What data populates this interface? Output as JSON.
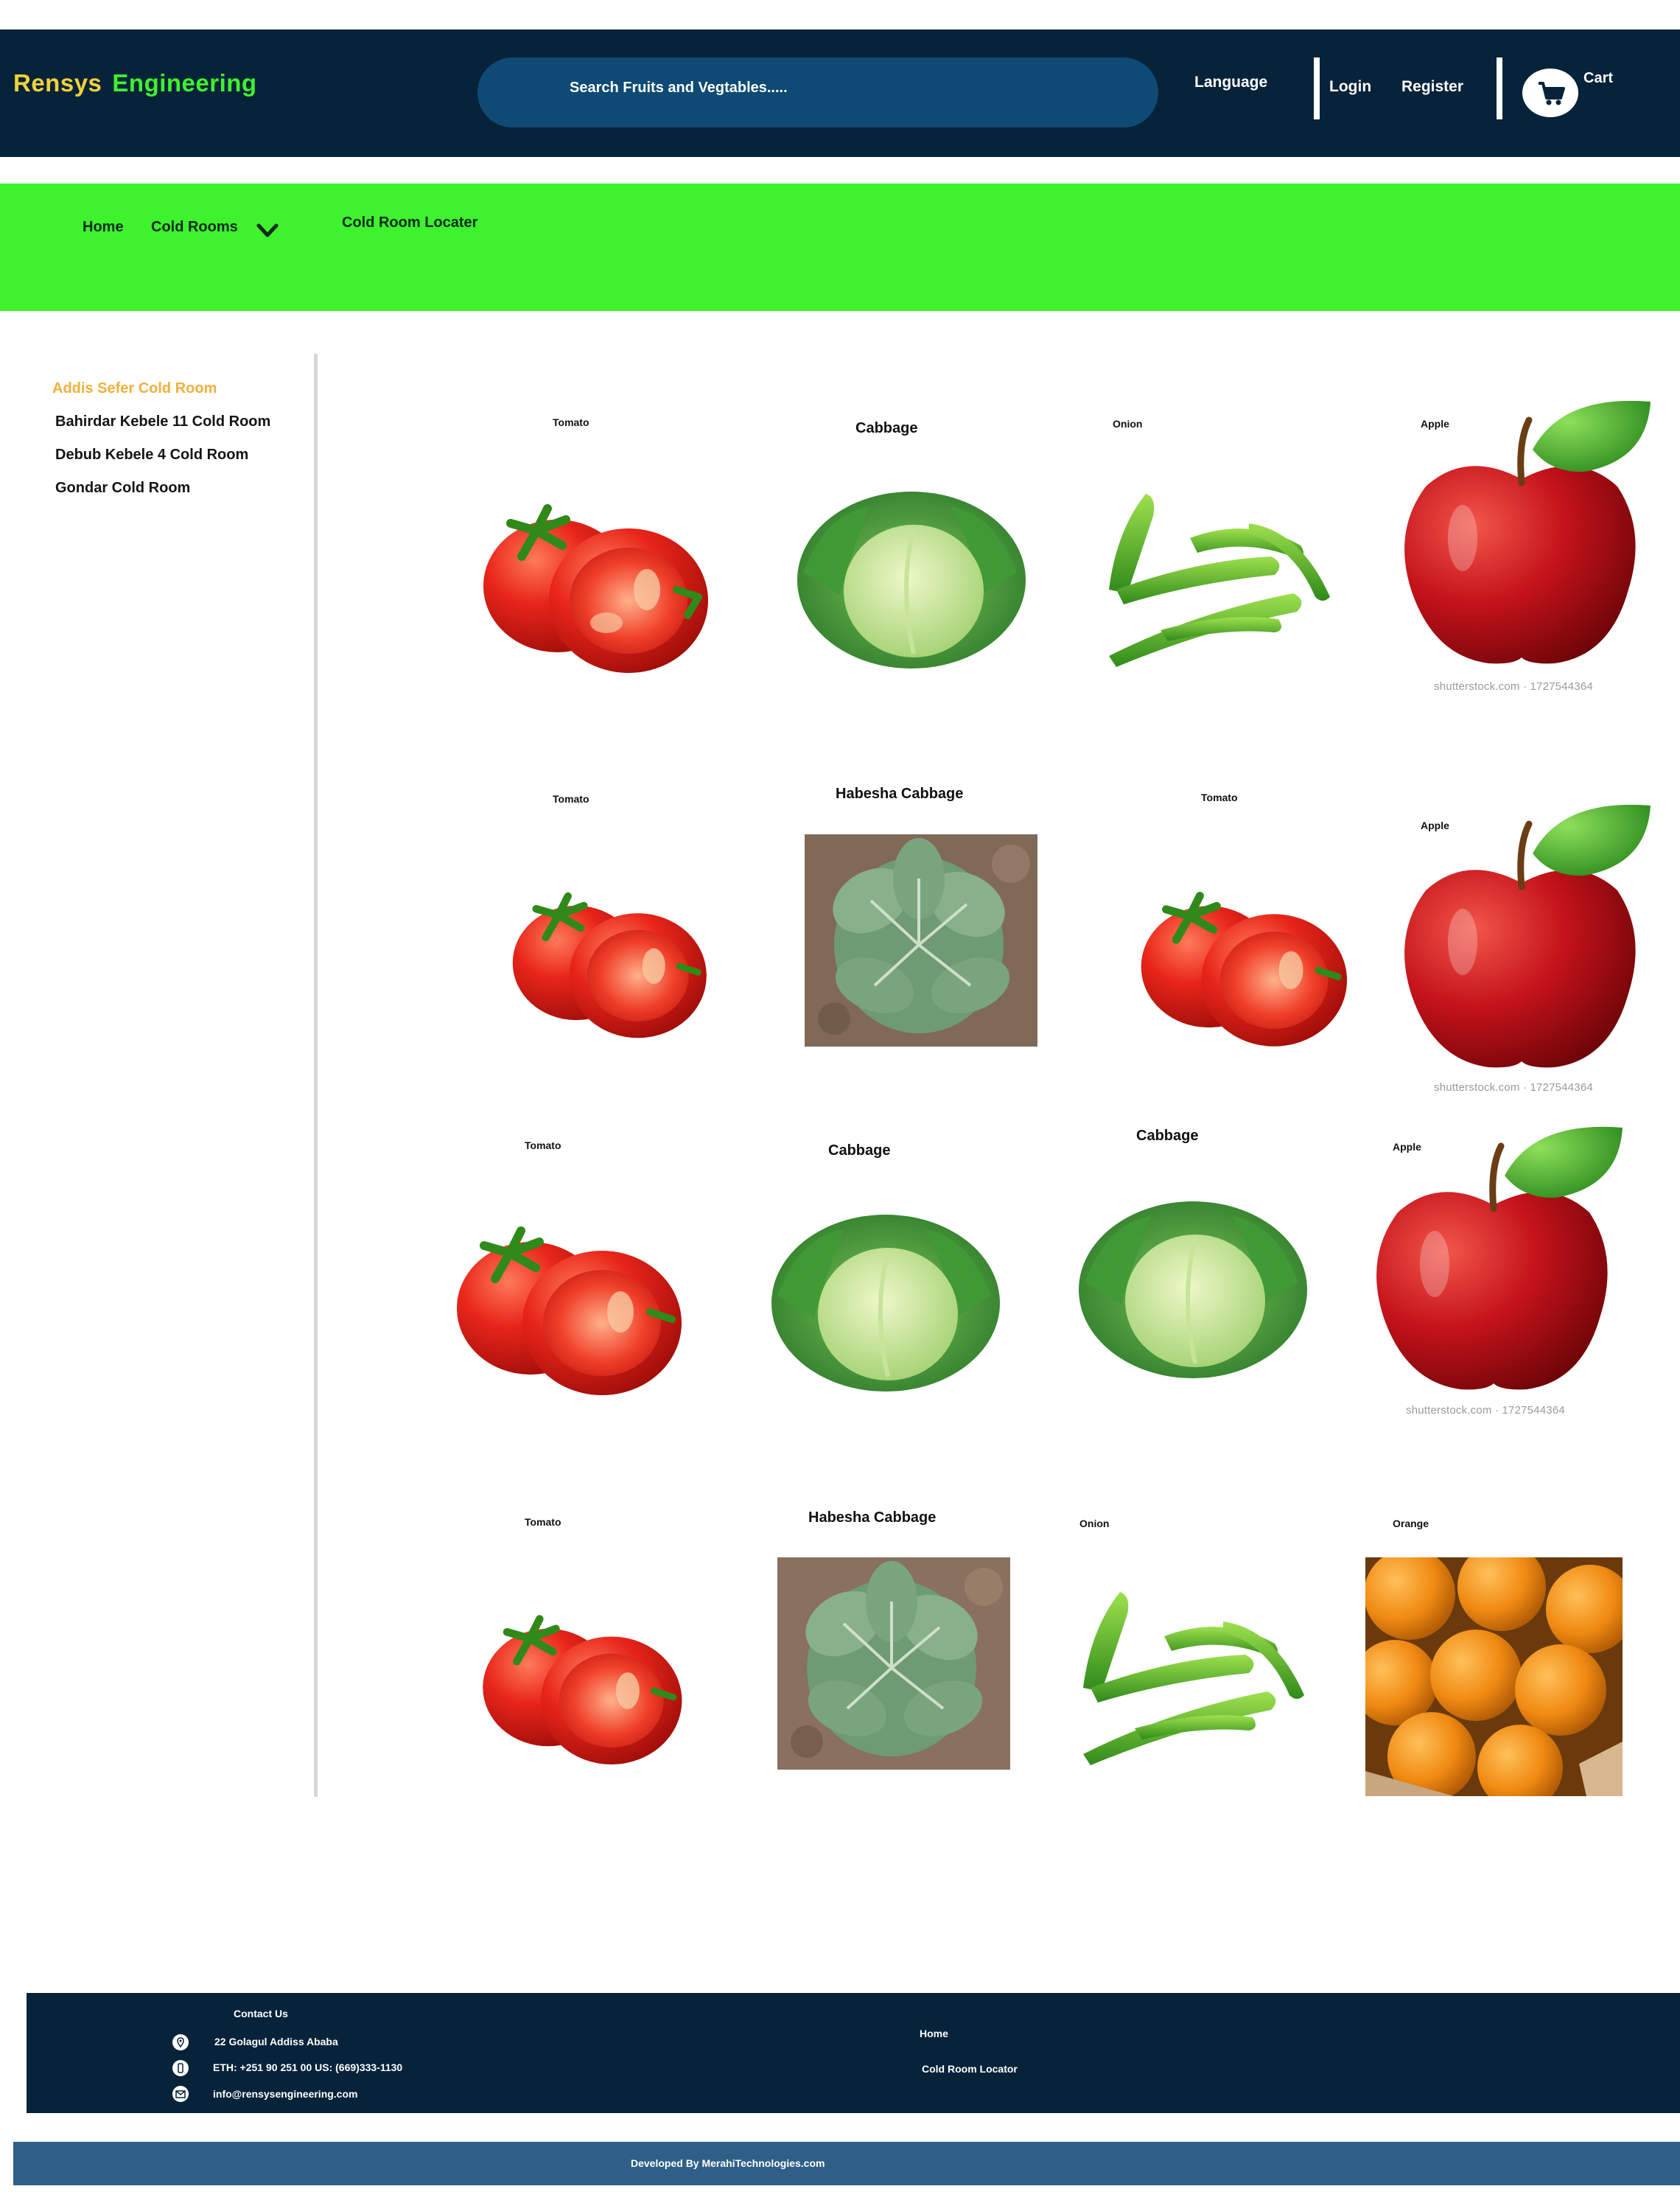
{
  "header": {
    "brand_part1": "Rensys",
    "brand_part2": "Engineering",
    "search_placeholder": "Search Fruits and Vegtables.....",
    "language": "Language",
    "login": "Login",
    "register": "Register",
    "cart": "Cart",
    "cart_icon": "shopping-cart-icon"
  },
  "nav": {
    "home": "Home",
    "cold_rooms": "Cold Rooms",
    "cold_rooms_icon": "chevron-down-icon",
    "cold_room_locater": "Cold Room Locater"
  },
  "sidebar": {
    "items": [
      {
        "label": "Addis Sefer Cold Room",
        "active": true
      },
      {
        "label": "Bahirdar Kebele 11 Cold Room",
        "active": false
      },
      {
        "label": "Debub Kebele 4 Cold Room",
        "active": false
      },
      {
        "label": "Gondar Cold Room",
        "active": false
      }
    ]
  },
  "products": [
    {
      "name": "Tomato"
    },
    {
      "name": "Cabbage"
    },
    {
      "name": "Onion"
    },
    {
      "name": "Apple",
      "watermark": "shutterstock.com · 1727544364"
    },
    {
      "name": "Tomato"
    },
    {
      "name": "Habesha Cabbage"
    },
    {
      "name": "Tomato"
    },
    {
      "name": "Apple",
      "watermark": "shutterstock.com · 1727544364"
    },
    {
      "name": "Tomato"
    },
    {
      "name": "Cabbage"
    },
    {
      "name": "Cabbage"
    },
    {
      "name": "Apple",
      "watermark": "shutterstock.com · 1727544364"
    },
    {
      "name": "Tomato"
    },
    {
      "name": "Habesha Cabbage"
    },
    {
      "name": "Onion"
    },
    {
      "name": "Orange"
    }
  ],
  "footer": {
    "contact_title": "Contact Us",
    "address": "22 Golagul Addiss Ababa",
    "phone": "ETH: +251 90 251 00 US: (669)333-1130",
    "email": "info@rensysengineering.com",
    "links": [
      "Home",
      "Cold Room  Locator"
    ],
    "credits": "Developed By  MerahiTechnologies.com"
  },
  "colors": {
    "header_bg": "#07233a",
    "nav_bg": "#3ef22e",
    "brand_yellow": "#f0d23a",
    "brand_green": "#3ef22e",
    "active_link": "#f2b03a",
    "footer_bg": "#07233a",
    "credits_bg": "#2f5f86"
  }
}
